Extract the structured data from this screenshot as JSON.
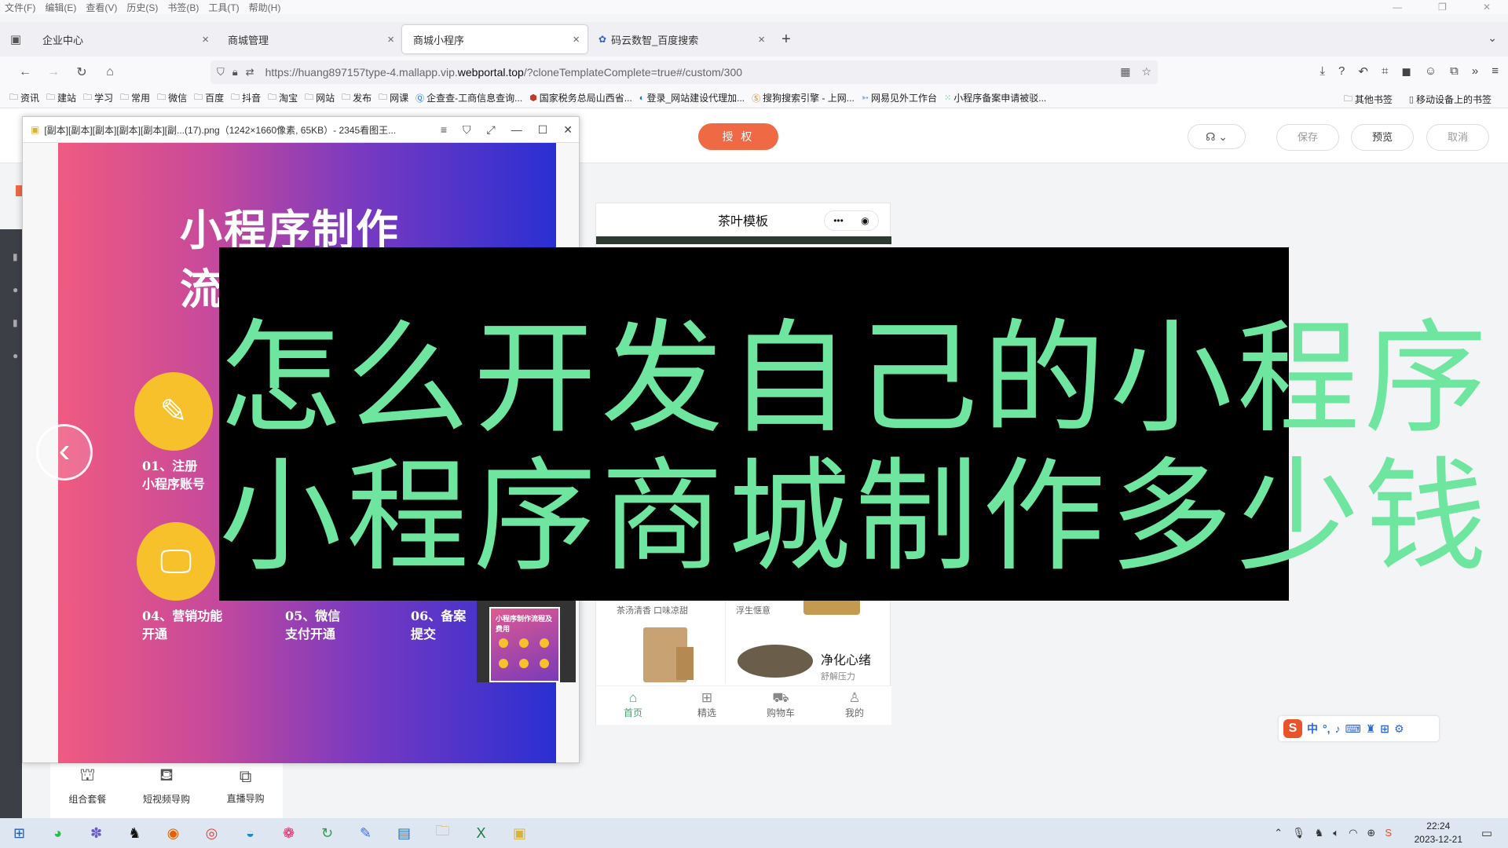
{
  "menubar": {
    "items": [
      "文件(F)",
      "编辑(E)",
      "查看(V)",
      "历史(S)",
      "书签(B)",
      "工具(T)",
      "帮助(H)"
    ]
  },
  "tabs": [
    {
      "label": "企业中心",
      "active": false
    },
    {
      "label": "商城管理",
      "active": false
    },
    {
      "label": "商城小程序",
      "active": true
    },
    {
      "label": "码云数智_百度搜索",
      "active": false
    }
  ],
  "address": {
    "url_prefix": "https://huang897157type-4.mallapp.vip.",
    "url_domain": "webportal.top",
    "url_suffix": "/?cloneTemplateComplete=true#/custom/300"
  },
  "bookmarks": {
    "items": [
      "资讯",
      "建站",
      "学习",
      "常用",
      "微信",
      "百度",
      "抖音",
      "淘宝",
      "网站",
      "发布",
      "网课",
      "企查查-工商信息查询...",
      "国家税务总局山西省...",
      "登录_网站建设代理加...",
      "搜狗搜索引擎 - 上网...",
      "网易见外工作台",
      "小程序备案申请被驳..."
    ],
    "right": [
      "其他书签",
      "移动设备上的书签"
    ]
  },
  "page": {
    "auth_button": "授 权",
    "save": "保存",
    "preview": "预览",
    "cancel": "取消"
  },
  "bottom_tools": [
    "组合套餐",
    "短视频导购",
    "直播导购"
  ],
  "phone": {
    "title": "茶叶模板",
    "row_left": "茶汤清香 口味凉甜",
    "row_right": "浮生惬意",
    "product_title": "净化心绪",
    "product_sub": "舒解压力",
    "tabs": [
      "首页",
      "精选",
      "购物车",
      "我的"
    ]
  },
  "viewer": {
    "title": "[副本][副本][副本][副本][副本][副...(17).png（1242×1660像素, 65KB）- 2345看图王...",
    "poster_title_1": "小程序制作",
    "poster_title_2": "流",
    "steps": [
      {
        "line1": "01、注册",
        "line2": "小程序账号"
      },
      {
        "line1": "04、营销功能",
        "line2": "开通"
      },
      {
        "line1": "05、微信",
        "line2": "支付开通"
      },
      {
        "line1": "06、备案",
        "line2": "提交"
      }
    ],
    "thumb_caption": "小程序制作流程及费用"
  },
  "overlay": {
    "line1": "怎么开发自己的小程序",
    "line2": "小程序商城制作多少钱",
    "color": "#6ee6a0"
  },
  "ime": {
    "label": "中"
  },
  "taskbar": {
    "time": "22:24",
    "date": "2023-12-21"
  }
}
